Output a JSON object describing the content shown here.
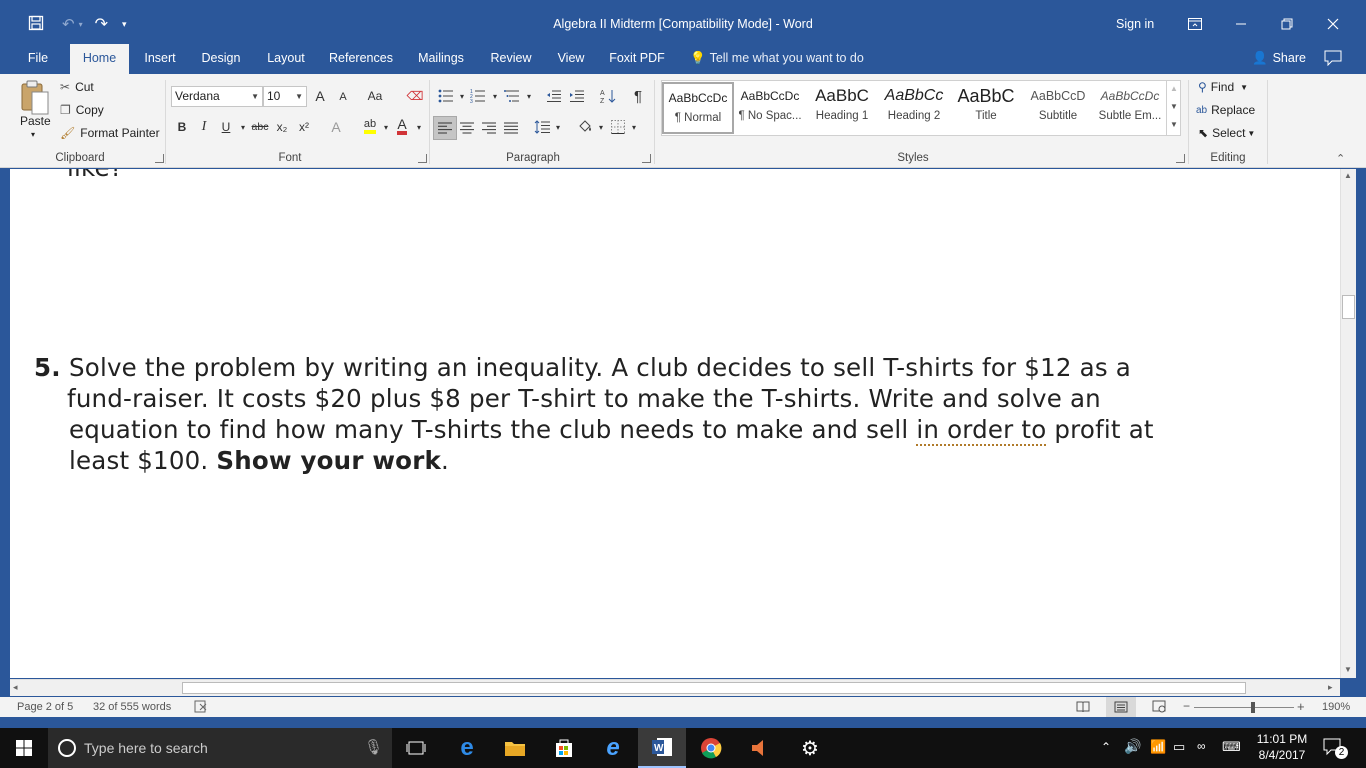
{
  "titlebar": {
    "title": "Algebra II Midterm [Compatibility Mode]  -  Word",
    "sign_in": "Sign in"
  },
  "tabs": [
    "File",
    "Home",
    "Insert",
    "Design",
    "Layout",
    "References",
    "Mailings",
    "Review",
    "View",
    "Foxit PDF"
  ],
  "active_tab": "Home",
  "tell_me": "Tell me what you want to do",
  "share": "Share",
  "clipboard": {
    "paste": "Paste",
    "cut": "Cut",
    "copy": "Copy",
    "format_painter": "Format Painter",
    "label": "Clipboard"
  },
  "font": {
    "name": "Verdana",
    "size": "10",
    "label": "Font",
    "bold": "B",
    "italic": "I",
    "underline": "U",
    "strike": "abc",
    "subscript": "x₂",
    "superscript": "x²",
    "grow": "A",
    "shrink": "A",
    "case": "Aa",
    "effects": "A",
    "highlight": "ab",
    "color": "A",
    "accent_color": "#d13438",
    "highlight_color": "#ffff00"
  },
  "paragraph": {
    "label": "Paragraph",
    "pilcrow": "¶"
  },
  "styles": {
    "label": "Styles",
    "items": [
      {
        "preview": "AaBbCcDc",
        "name": "¶ Normal"
      },
      {
        "preview": "AaBbCcDc",
        "name": "¶ No Spac..."
      },
      {
        "preview": "AaBbC",
        "name": "Heading 1"
      },
      {
        "preview": "AaBbCc",
        "name": "Heading 2"
      },
      {
        "preview": "AaBbC",
        "name": "Title"
      },
      {
        "preview": "AaBbCcD",
        "name": "Subtitle"
      },
      {
        "preview": "AaBbCcDc",
        "name": "Subtle Em..."
      }
    ]
  },
  "editing": {
    "label": "Editing",
    "find": "Find",
    "replace": "Replace",
    "select": "Select"
  },
  "document": {
    "fragment": "like?",
    "q_number": "5.",
    "line1": "Solve the problem by writing an inequality. A club decides to sell T-shirts for $12 as a",
    "line2": "fund-raiser. It costs $20 plus $8 per T-shirt to make the T-shirts. Write and solve an",
    "line3a": "equation to find how many T-shirts the club needs to make and sell ",
    "line3b": "in order to",
    "line3c": " profit at",
    "line4a": "least $100. ",
    "line4b": "Show your work",
    "line4c": "."
  },
  "status": {
    "page": "Page 2 of 5",
    "words": "32 of 555 words",
    "zoom": "190%"
  },
  "taskbar": {
    "search_placeholder": "Type here to search",
    "time": "11:01 PM",
    "date": "8/4/2017",
    "notifications": "2"
  },
  "colors": {
    "word_blue": "#2b579a",
    "ribbon_bg": "#f3f3f3"
  }
}
